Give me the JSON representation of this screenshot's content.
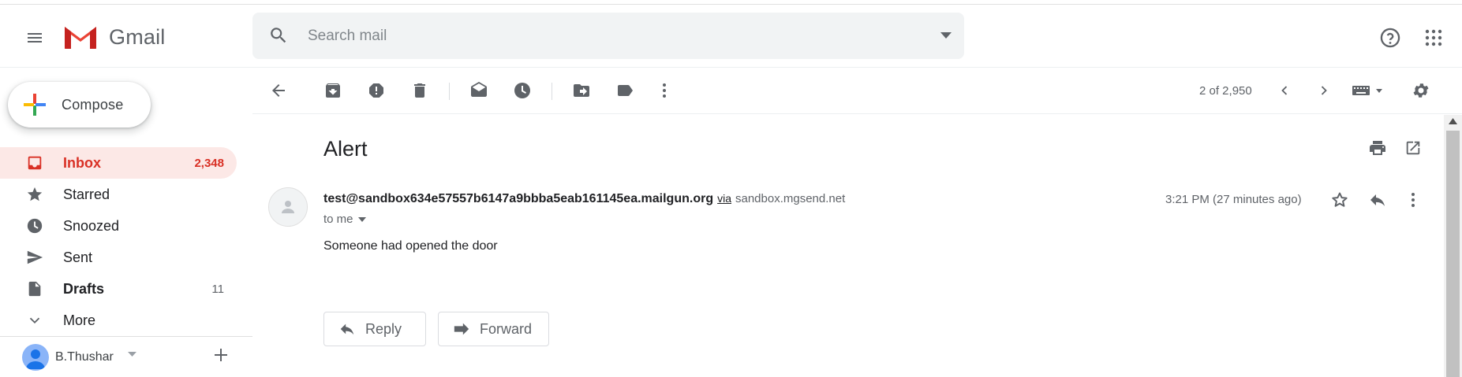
{
  "app": {
    "name": "Gmail"
  },
  "search": {
    "placeholder": "Search mail"
  },
  "sidebar": {
    "compose_label": "Compose",
    "items": [
      {
        "label": "Inbox",
        "count": "2,348",
        "icon": "inbox-icon",
        "active": true
      },
      {
        "label": "Starred",
        "count": "",
        "icon": "star-icon"
      },
      {
        "label": "Snoozed",
        "count": "",
        "icon": "clock-icon"
      },
      {
        "label": "Sent",
        "count": "",
        "icon": "send-icon"
      },
      {
        "label": "Drafts",
        "count": "11",
        "icon": "draft-icon"
      },
      {
        "label": "More",
        "count": "",
        "icon": "chevron-down-icon"
      }
    ],
    "account_name": "B.Thushar"
  },
  "toolbar": {
    "pager": "2 of 2,950"
  },
  "message": {
    "subject": "Alert",
    "sender": "test@sandbox634e57557b6147a9bbba5eab161145ea.mailgun.org",
    "via_label": "via",
    "via_domain": "sandbox.mgsend.net",
    "to": "to me",
    "time": "3:21 PM (27 minutes ago)",
    "body": "Someone had opened the door",
    "reply_label": "Reply",
    "forward_label": "Forward"
  },
  "colors": {
    "accent_red": "#d93025",
    "active_bg": "#fce8e6",
    "icon_gray": "#5f6368"
  }
}
